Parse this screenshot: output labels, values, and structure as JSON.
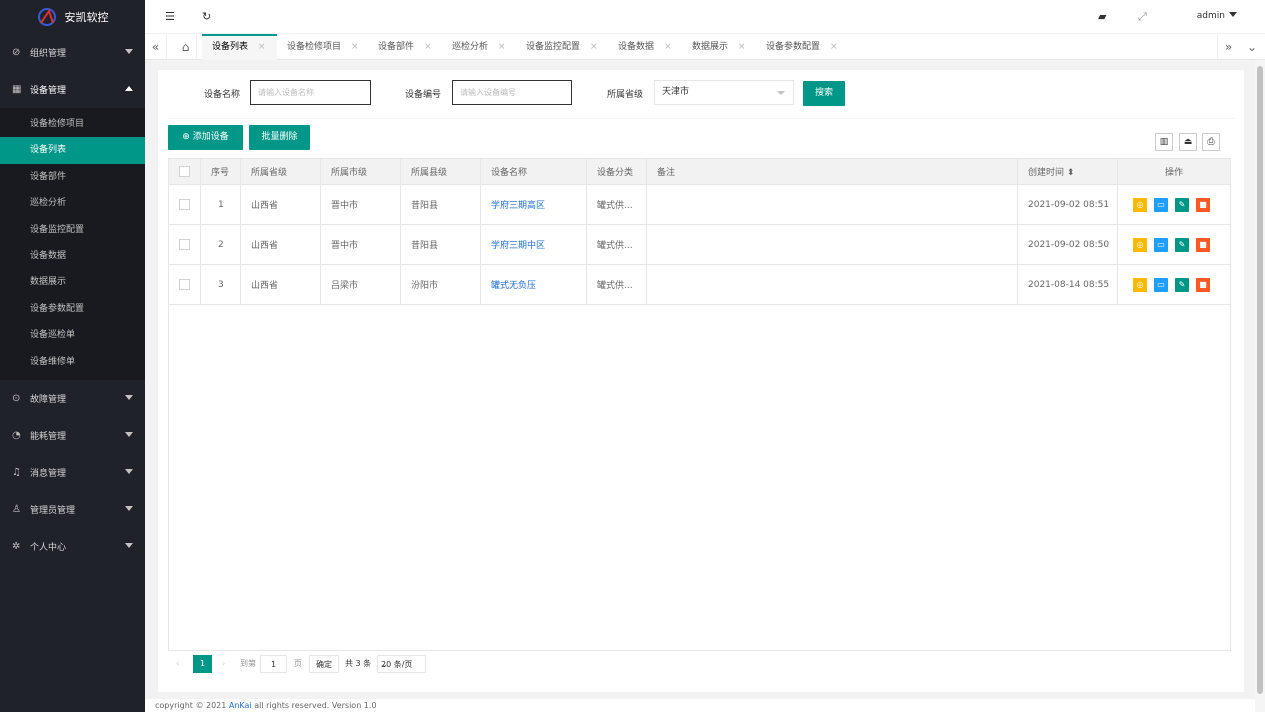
{
  "app": {
    "name": "安凯软控"
  },
  "sidebar": {
    "groups": [
      {
        "label": "组织管理",
        "icon": "tag-icon"
      },
      {
        "label": "设备管理",
        "icon": "grid-icon"
      },
      {
        "label": "故障管理",
        "icon": "shield-icon"
      },
      {
        "label": "能耗管理",
        "icon": "gauge-icon"
      },
      {
        "label": "消息管理",
        "icon": "bell-icon"
      },
      {
        "label": "管理员管理",
        "icon": "user-icon"
      },
      {
        "label": "个人中心",
        "icon": "gear-icon"
      }
    ],
    "sub_items": [
      "设备检修项目",
      "设备列表",
      "设备部件",
      "巡检分析",
      "设备监控配置",
      "设备数据",
      "数据展示",
      "设备参数配置",
      "设备巡检单",
      "设备维修单"
    ]
  },
  "topbar": {
    "user": "admin"
  },
  "tabs": [
    "设备列表",
    "设备检修项目",
    "设备部件",
    "巡检分析",
    "设备监控配置",
    "设备数据",
    "数据展示",
    "设备参数配置"
  ],
  "search": {
    "name_label": "设备名称",
    "name_placeholder": "请输入设备名称",
    "code_label": "设备编号",
    "code_placeholder": "请输入设备编号",
    "province_label": "所属省级",
    "province_value": "天津市",
    "search_button": "搜索"
  },
  "actions": {
    "add": "添加设备",
    "batch_delete": "批量删除"
  },
  "table": {
    "headers": [
      "序号",
      "所属省级",
      "所属市级",
      "所属县级",
      "设备名称",
      "设备分类",
      "备注",
      "创建时间",
      "操作"
    ],
    "rows": [
      {
        "no": "1",
        "province": "山西省",
        "city": "晋中市",
        "county": "昔阳县",
        "name": "学府三期高区",
        "category": "罐式供...",
        "remark": "",
        "created": "2021-09-02 08:51"
      },
      {
        "no": "2",
        "province": "山西省",
        "city": "晋中市",
        "county": "昔阳县",
        "name": "学府三期中区",
        "category": "罐式供...",
        "remark": "",
        "created": "2021-09-02 08:50"
      },
      {
        "no": "3",
        "province": "山西省",
        "city": "吕梁市",
        "county": "汾阳市",
        "name": "罐式无负压",
        "category": "罐式供...",
        "remark": "",
        "created": "2021-08-14 08:55"
      }
    ]
  },
  "pager": {
    "current": "1",
    "goto_label": "到第",
    "page_input": "1",
    "page_unit": "页",
    "confirm": "确定",
    "total": "共 3 条",
    "page_size": "20 条/页"
  },
  "footer": {
    "prefix": "copyright © 2021 ",
    "brand": "AnKai",
    "suffix": " all rights reserved. Version 1.0"
  },
  "colors": {
    "primary": "#009688",
    "sidebar": "#20222a",
    "link": "#1e6fd9",
    "op_orange": "#ffb800",
    "op_blue": "#1e9fff",
    "op_green": "#009688",
    "op_red": "#ff5722"
  }
}
